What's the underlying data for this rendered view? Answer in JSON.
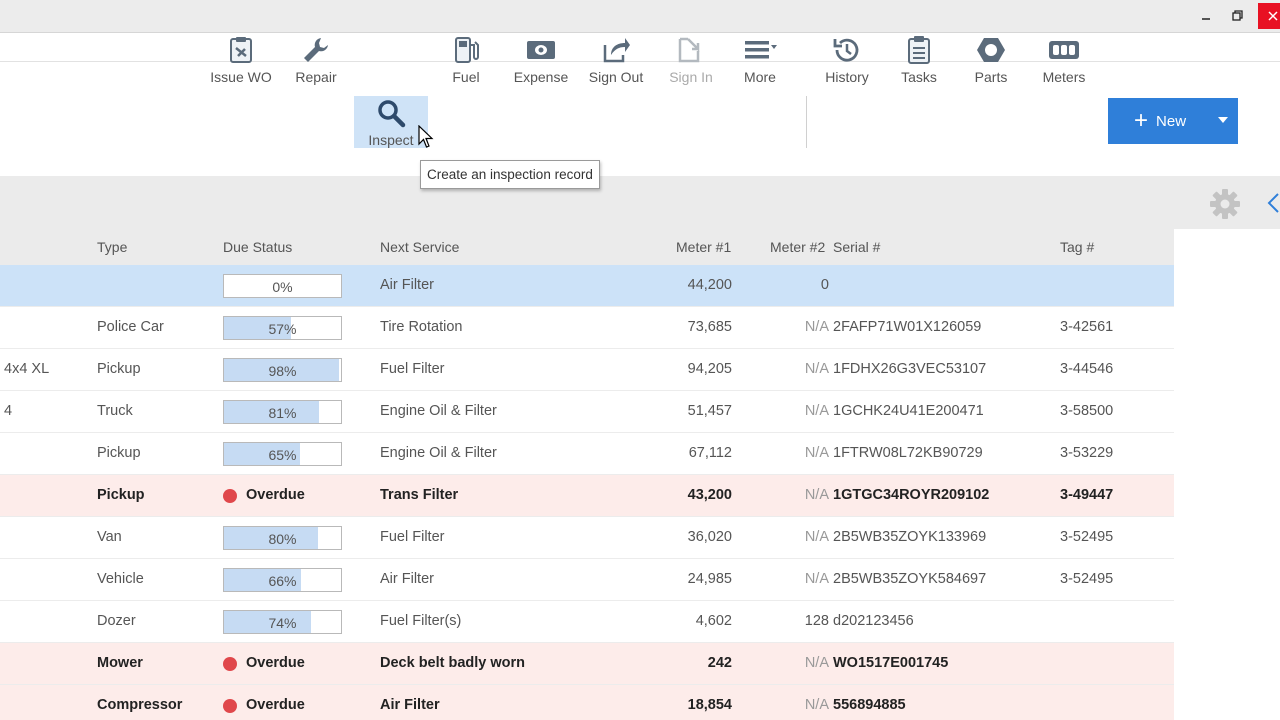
{
  "window": {
    "min_icon": "minimize-icon",
    "max_icon": "restore-icon",
    "close_icon": "close-icon"
  },
  "toolbar": {
    "buttons": [
      {
        "label": "Issue WO",
        "icon": "work-order-icon"
      },
      {
        "label": "Repair",
        "icon": "wrench-icon"
      },
      {
        "label": "Inspect",
        "icon": "magnifier-icon",
        "active": true
      },
      {
        "label": "Fuel",
        "icon": "fuel-pump-icon"
      },
      {
        "label": "Expense",
        "icon": "money-icon"
      },
      {
        "label": "Sign Out",
        "icon": "share-icon"
      },
      {
        "label": "Sign In",
        "icon": "sign-in-icon",
        "disabled": true
      },
      {
        "label": "More",
        "icon": "more-menu-icon"
      },
      {
        "label": "History",
        "icon": "history-icon"
      },
      {
        "label": "Tasks",
        "icon": "clipboard-icon"
      },
      {
        "label": "Parts",
        "icon": "hex-nut-icon"
      },
      {
        "label": "Meters",
        "icon": "odometer-icon"
      }
    ],
    "new_label": "New"
  },
  "tooltip": "Create an inspection record",
  "columns": {
    "type": "Type",
    "due_status": "Due Status",
    "next_service": "Next Service",
    "meter1": "Meter #1",
    "meter2": "Meter #2",
    "serial": "Serial #",
    "tag": "Tag #"
  },
  "rows": [
    {
      "left": "",
      "type": "",
      "status": "0%",
      "progress": 0,
      "next": "Air Filter",
      "m1": "44,200",
      "m2": "0",
      "serial": "",
      "tag": "",
      "state": "selected"
    },
    {
      "left": "",
      "type": "Police Car",
      "status": "57%",
      "progress": 57,
      "next": "Tire Rotation",
      "m1": "73,685",
      "m2": "N/A",
      "serial": "2FAFP71W01X126059",
      "tag": "3-42561",
      "state": "normal"
    },
    {
      "left": "4x4 XL",
      "type": "Pickup",
      "status": "98%",
      "progress": 98,
      "next": "Fuel Filter",
      "m1": "94,205",
      "m2": "N/A",
      "serial": "1FDHX26G3VEC53107",
      "tag": "3-44546",
      "state": "normal"
    },
    {
      "left": "4",
      "type": "Truck",
      "status": "81%",
      "progress": 81,
      "next": "Engine Oil & Filter",
      "m1": "51,457",
      "m2": "N/A",
      "serial": "1GCHK24U41E200471",
      "tag": "3-58500",
      "state": "normal"
    },
    {
      "left": "",
      "type": "Pickup",
      "status": "65%",
      "progress": 65,
      "next": "Engine Oil & Filter",
      "m1": "67,112",
      "m2": "N/A",
      "serial": "1FTRW08L72KB90729",
      "tag": "3-53229",
      "state": "normal"
    },
    {
      "left": "",
      "type": "Pickup",
      "status": "Overdue",
      "progress": null,
      "next": "Trans Filter",
      "m1": "43,200",
      "m2": "N/A",
      "serial": "1GTGC34ROYR209102",
      "tag": "3-49447",
      "state": "overdue"
    },
    {
      "left": "",
      "type": "Van",
      "status": "80%",
      "progress": 80,
      "next": "Fuel Filter",
      "m1": "36,020",
      "m2": "N/A",
      "serial": "2B5WB35ZOYK133969",
      "tag": "3-52495",
      "state": "normal"
    },
    {
      "left": "",
      "type": "Vehicle",
      "status": "66%",
      "progress": 66,
      "next": "Air Filter",
      "m1": "24,985",
      "m2": "N/A",
      "serial": "2B5WB35ZOYK584697",
      "tag": "3-52495",
      "state": "normal"
    },
    {
      "left": "",
      "type": "Dozer",
      "status": "74%",
      "progress": 74,
      "next": "Fuel Filter(s)",
      "m1": "4,602",
      "m2": "128",
      "serial": "d202123456",
      "tag": "",
      "state": "normal"
    },
    {
      "left": "",
      "type": "Mower",
      "status": "Overdue",
      "progress": null,
      "next": "Deck belt badly worn",
      "m1": "242",
      "m2": "N/A",
      "serial": "WO1517E001745",
      "tag": "",
      "state": "overdue"
    },
    {
      "left": "",
      "type": "Compressor",
      "status": "Overdue",
      "progress": null,
      "next": "Air Filter",
      "m1": "18,854",
      "m2": "N/A",
      "serial": "556894885",
      "tag": "",
      "state": "overdue"
    }
  ],
  "colors": {
    "accent": "#2f7fd9",
    "selected_row": "#cce2f8",
    "overdue_row": "#fdecea",
    "overdue_dot": "#e0474b",
    "progress_fill": "#c6dbf3"
  }
}
